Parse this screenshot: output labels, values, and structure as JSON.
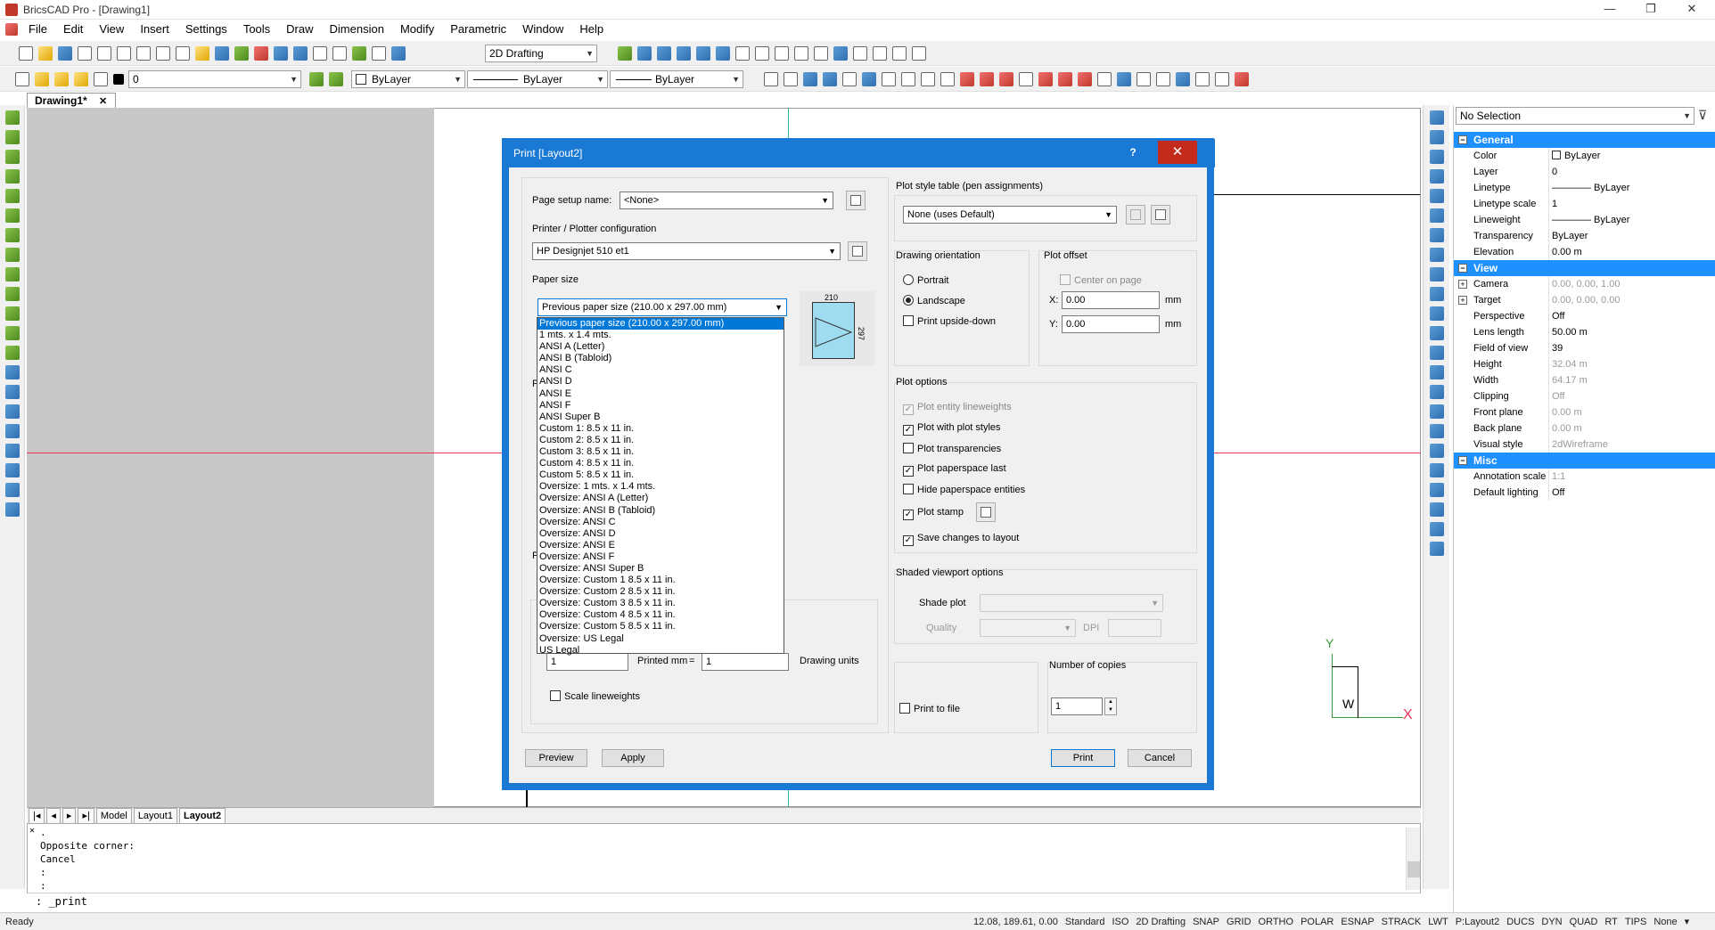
{
  "window": {
    "title": "BricsCAD Pro - [Drawing1]",
    "min": "—",
    "max": "❐",
    "close": "✕"
  },
  "menu": [
    "File",
    "Edit",
    "View",
    "Insert",
    "Settings",
    "Tools",
    "Draw",
    "Dimension",
    "Modify",
    "Parametric",
    "Window",
    "Help"
  ],
  "toolbar": {
    "workspace": "2D Drafting",
    "layer": "0",
    "color": "ByLayer",
    "linetype": "ByLayer",
    "lineweight": "ByLayer"
  },
  "doc_tab": {
    "label": "Drawing1*",
    "close": "✕"
  },
  "layout_tabs": [
    "Model",
    "Layout1",
    "Layout2"
  ],
  "command": {
    "history": [
      ".",
      "Opposite corner:",
      "Cancel",
      ":",
      ":"
    ],
    "prompt": ": _print"
  },
  "status": {
    "ready": "Ready",
    "coords": "12.08, 189.61, 0.00",
    "items": [
      "Standard",
      "ISO",
      "2D Drafting",
      "SNAP",
      "GRID",
      "ORTHO",
      "POLAR",
      "ESNAP",
      "STRACK",
      "LWT",
      "P:Layout2",
      "DUCS",
      "DYN",
      "QUAD",
      "RT",
      "TIPS",
      "None"
    ]
  },
  "properties": {
    "selection": "No Selection",
    "groups": [
      {
        "name": "General",
        "rows": [
          [
            "Color",
            "ByLayer"
          ],
          [
            "Layer",
            "0"
          ],
          [
            "Linetype",
            "———— ByLayer"
          ],
          [
            "Linetype scale",
            "1"
          ],
          [
            "Lineweight",
            "———— ByLayer"
          ],
          [
            "Transparency",
            "ByLayer"
          ],
          [
            "Elevation",
            "0.00 m"
          ]
        ]
      },
      {
        "name": "View",
        "rows": [
          [
            "Camera",
            "0.00, 0.00, 1.00"
          ],
          [
            "Target",
            "0.00, 0.00, 0.00"
          ],
          [
            "Perspective",
            "Off"
          ],
          [
            "Lens length",
            "50.00 m"
          ],
          [
            "Field of view",
            "39"
          ],
          [
            "Height",
            "32.04 m"
          ],
          [
            "Width",
            "64.17 m"
          ],
          [
            "Clipping",
            "Off"
          ],
          [
            "Front plane",
            "0.00 m"
          ],
          [
            "Back plane",
            "0.00 m"
          ],
          [
            "Visual style",
            "2dWireframe"
          ]
        ]
      },
      {
        "name": "Misc",
        "rows": [
          [
            "Annotation scale",
            "1:1"
          ],
          [
            "Default lighting",
            "Off"
          ]
        ]
      }
    ]
  },
  "dialog": {
    "title": "Print [Layout2]",
    "help": "?",
    "close": "✕",
    "page_setup_label": "Page setup name:",
    "page_setup_value": "<None>",
    "printer_group": "Printer / Plotter configuration",
    "printer_value": "HP Designjet 510 et1",
    "paper_size_label": "Paper size",
    "paper_size_value": "Previous paper size (210.00 x 297.00 mm)",
    "paper_preview_w": "210",
    "paper_preview_h": "297",
    "paper_options": [
      "Previous paper size (210.00 x 297.00 mm)",
      "1 mts. x 1.4 mts.",
      "ANSI A (Letter)",
      "ANSI B (Tabloid)",
      "ANSI C",
      "ANSI D",
      "ANSI E",
      "ANSI F",
      "ANSI Super B",
      "Custom 1:  8.5  x  11 in.",
      "Custom 2:  8.5  x  11 in.",
      "Custom 3:  8.5  x  11 in.",
      "Custom 4:  8.5  x  11 in.",
      "Custom 5:  8.5  x  11 in.",
      "Oversize: 1 mts. x 1.4 mts.",
      "Oversize: ANSI A (Letter)",
      "Oversize: ANSI B (Tabloid)",
      "Oversize: ANSI C",
      "Oversize: ANSI D",
      "Oversize: ANSI E",
      "Oversize: ANSI F",
      "Oversize: ANSI Super B",
      "Oversize: Custom 1 8.5  x  11 in.",
      "Oversize: Custom 2 8.5  x  11 in.",
      "Oversize: Custom 3 8.5  x  11 in.",
      "Oversize: Custom 4 8.5  x  11 in.",
      "Oversize: Custom 5 8.5  x  11 in.",
      "Oversize: US Legal",
      "US Legal"
    ],
    "hidden_p1": "P",
    "hidden_p2": "P",
    "scale_value1": "1",
    "printed_mm": "Printed mm",
    "equals": "=",
    "scale_value2": "1",
    "drawing_units": "Drawing units",
    "scale_lineweights": "Scale lineweights",
    "plot_style_group": "Plot style table (pen assignments)",
    "plot_style_value": "None (uses Default)",
    "orientation_group": "Drawing orientation",
    "portrait": "Portrait",
    "landscape": "Landscape",
    "upside_down": "Print upside-down",
    "offset_group": "Plot offset",
    "center_on_page": "Center on page",
    "x_label": "X:",
    "x_value": "0.00",
    "y_label": "Y:",
    "y_value": "0.00",
    "unit": "mm",
    "plot_options_group": "Plot options",
    "plot_options": [
      {
        "label": "Plot entity lineweights",
        "checked": true,
        "disabled": true
      },
      {
        "label": "Plot with plot styles",
        "checked": true,
        "disabled": false
      },
      {
        "label": "Plot transparencies",
        "checked": false,
        "disabled": false
      },
      {
        "label": "Plot paperspace last",
        "checked": true,
        "disabled": false
      },
      {
        "label": "Hide paperspace entities",
        "checked": false,
        "disabled": false
      },
      {
        "label": "Plot stamp",
        "checked": true,
        "disabled": false
      },
      {
        "label": "Save changes to layout",
        "checked": true,
        "disabled": false
      }
    ],
    "shaded_group": "Shaded viewport options",
    "shade_plot": "Shade plot",
    "quality": "Quality",
    "dpi": "DPI",
    "copies_group": "Number of copies",
    "copies_value": "1",
    "print_to_file": "Print to file",
    "preview": "Preview",
    "apply": "Apply",
    "print": "Print",
    "cancel": "Cancel",
    "check": "✓"
  },
  "ucs": {
    "y": "Y",
    "x": "X",
    "w": "W"
  }
}
